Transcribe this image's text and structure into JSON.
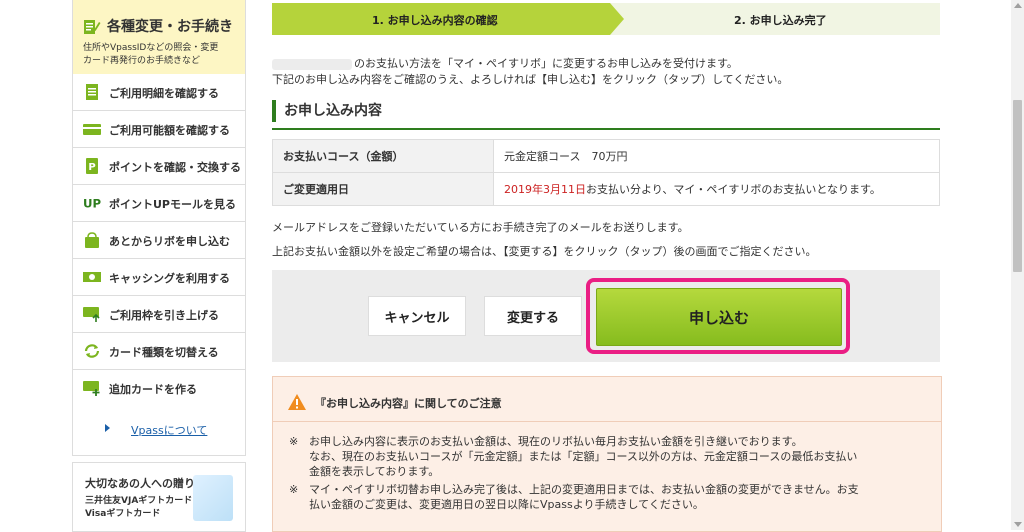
{
  "sidebar": {
    "header": {
      "title": "各種変更・お手続き",
      "desc_line1": "住所やVpassIDなどの照会・変更",
      "desc_line2": "カード再発行のお手続きなど"
    },
    "items": [
      {
        "label": "ご利用明細を確認する",
        "icon": "document-icon"
      },
      {
        "label": "ご利用可能額を確認する",
        "icon": "card-icon"
      },
      {
        "label": "ポイントを確認・交換する",
        "icon": "point-icon"
      },
      {
        "label": "ポイントUPモールを見る",
        "icon": "up-icon"
      },
      {
        "label": "あとからリボを申し込む",
        "icon": "bag-icon"
      },
      {
        "label": "キャッシングを利用する",
        "icon": "cash-icon"
      },
      {
        "label": "ご利用枠を引き上げる",
        "icon": "card-up-icon"
      },
      {
        "label": "カード種類を切替える",
        "icon": "refresh-icon"
      },
      {
        "label": "追加カードを作る",
        "icon": "card-add-icon"
      }
    ],
    "link": "Vpassについて",
    "banner": {
      "line1": "大切なあの人への贈り物",
      "line2": "三井住友VJAギフトカード",
      "line3": "Visaギフトカード"
    }
  },
  "steps": {
    "step1": "1. お申し込み内容の確認",
    "step2": "2. お申し込み完了"
  },
  "intro": {
    "line1": "のお支払い方法を「マイ・ペイすリボ」に変更するお申し込みを受付けます。",
    "line2": "下記のお申し込み内容をご確認のうえ、よろしければ【申し込む】をクリック（タップ）してください。"
  },
  "section_title": "お申し込み内容",
  "table": {
    "row1": {
      "label": "お支払いコース（金額）",
      "value": "元金定額コース　70万円"
    },
    "row2": {
      "label": "ご変更適用日",
      "date": "2019年3月11日",
      "value": "お支払い分より、マイ・ペイすリボのお支払いとなります。"
    }
  },
  "notes": {
    "line1": "メールアドレスをご登録いただいている方にお手続き完了のメールをお送りします。",
    "line2": "上記お支払い金額以外を設定ご希望の場合は、【変更する】をクリック（タップ）後の画面でご指定ください。"
  },
  "buttons": {
    "cancel": "キャンセル",
    "change": "変更する",
    "apply": "申し込む"
  },
  "caution": {
    "title": "『お申し込み内容』に関してのご注意",
    "mark": "※",
    "item1_l1": "お申し込み内容に表示のお支払い金額は、現在のリボ払い毎月お支払い金額を引き継いでおります。",
    "item1_l2": "なお、現在のお支払いコースが「元金定額」または「定額」コース以外の方は、元金定額コースの最低お支払い",
    "item1_l3": "金額を表示しております。",
    "item2_l1": "マイ・ペイすリボ切替お申し込み完了後は、上記の変更適用日までは、お支払い金額の変更ができません。お支",
    "item2_l2": "払い金額のご変更は、変更適用日の翌日以降にVpassより手続きしてください。"
  },
  "colors": {
    "accent_green": "#b5d33b",
    "heading_green": "#2e7d1e",
    "highlight_pink": "#ea1e84",
    "date_red": "#cc2222"
  }
}
